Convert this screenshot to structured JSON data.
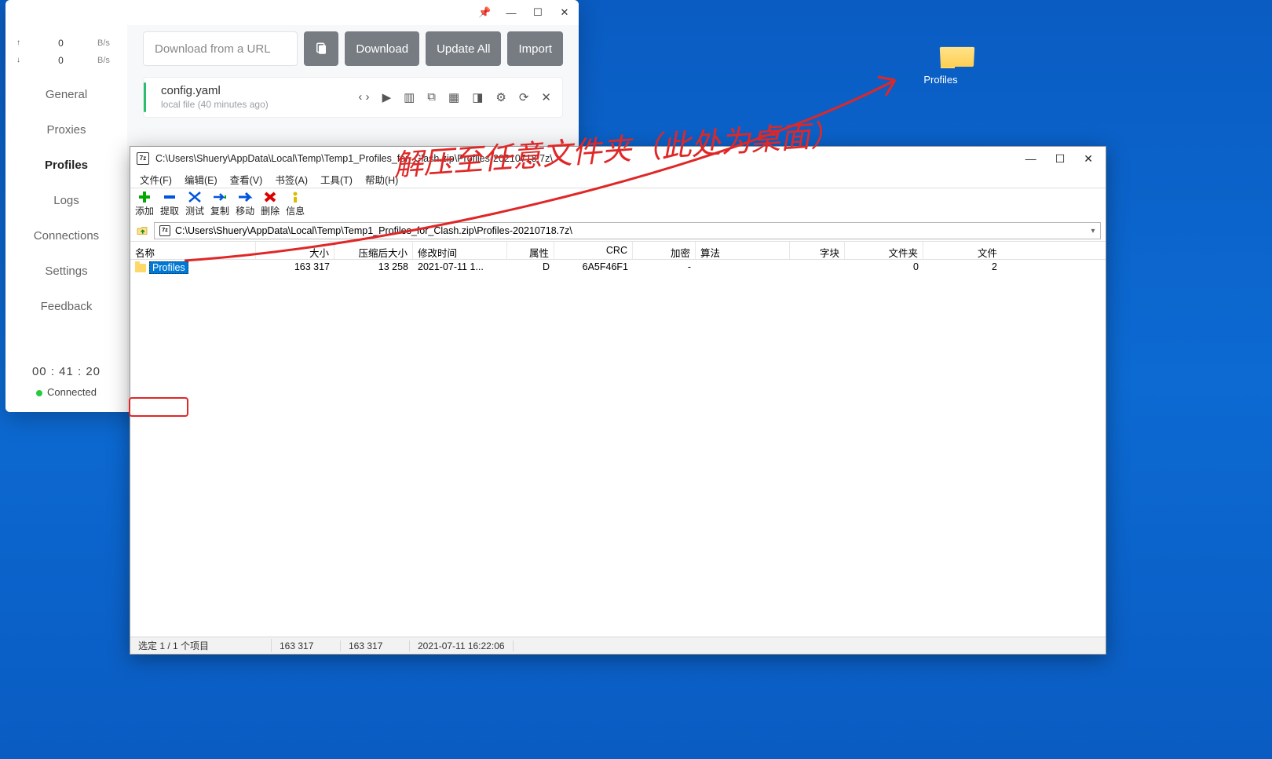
{
  "desktop": {
    "folder_label": "Profiles"
  },
  "clash": {
    "titlebar": {
      "pin": "📌",
      "min": "—",
      "max": "☐",
      "close": "✕"
    },
    "net": {
      "up_arrow": "↑",
      "down_arrow": "↓",
      "up_val": "0",
      "down_val": "0",
      "unit": "B/s"
    },
    "nav": [
      "General",
      "Proxies",
      "Profiles",
      "Logs",
      "Connections",
      "Settings",
      "Feedback"
    ],
    "nav_active_index": 2,
    "timer": "00 : 41 : 20",
    "status": "Connected",
    "url_placeholder": "Download from a URL",
    "buttons": {
      "download": "Download",
      "update_all": "Update All",
      "import": "Import"
    },
    "profile": {
      "name": "config.yaml",
      "sub": "local file (40 minutes ago)"
    },
    "icons": {
      "code": "‹ ›",
      "play": "▶",
      "book": "▥",
      "copy": "⧉",
      "qr": "▦",
      "diff": "◨",
      "gear": "⚙",
      "refresh": "⟳",
      "close": "✕"
    }
  },
  "seven": {
    "title": "C:\\Users\\Shuery\\AppData\\Local\\Temp\\Temp1_Profiles_for_Clash.zip\\Profiles-20210718.7z\\",
    "menus": [
      "文件(F)",
      "编辑(E)",
      "查看(V)",
      "书签(A)",
      "工具(T)",
      "帮助(H)"
    ],
    "toolbar": [
      "添加",
      "提取",
      "测试",
      "复制",
      "移动",
      "删除",
      "信息"
    ],
    "path": "C:\\Users\\Shuery\\AppData\\Local\\Temp\\Temp1_Profiles_for_Clash.zip\\Profiles-20210718.7z\\",
    "headers": {
      "name": "名称",
      "size": "大小",
      "packed": "压缩后大小",
      "mod": "修改时间",
      "attr": "属性",
      "crc": "CRC",
      "enc": "加密",
      "alg": "算法",
      "block": "字块",
      "folders": "文件夹",
      "files": "文件"
    },
    "row": {
      "name": "Profiles",
      "size": "163 317",
      "packed": "13 258",
      "mod": "2021-07-11 1...",
      "attr": "D",
      "crc": "6A5F46F1",
      "enc": "-",
      "alg": "",
      "block": "",
      "folders": "0",
      "files": "2"
    },
    "status": {
      "sel": "选定 1 / 1 个项目",
      "s1": "163 317",
      "s2": "163 317",
      "date": "2021-07-11 16:22:06"
    },
    "logo": "7z"
  },
  "annotation": {
    "text": "解压至任意文件夹（此处为桌面）"
  }
}
